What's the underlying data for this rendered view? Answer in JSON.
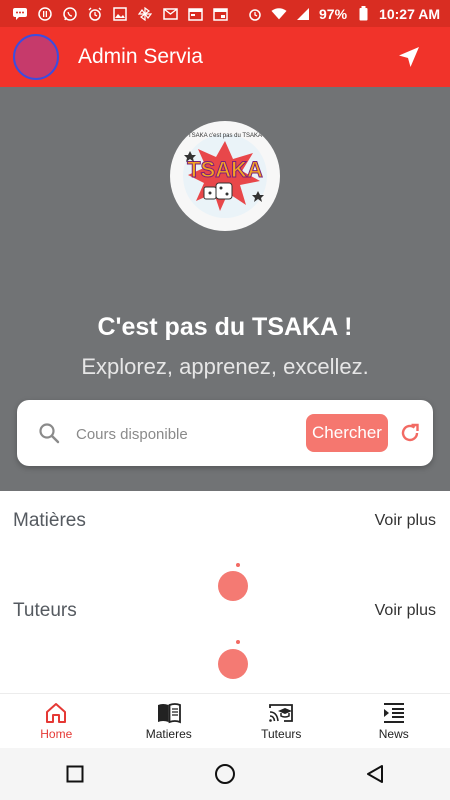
{
  "status_bar": {
    "battery": "97%",
    "time": "10:27 AM"
  },
  "app_bar": {
    "title": "Admin Servia"
  },
  "hero": {
    "logo_text": "TSAKA",
    "logo_ring_text": "TSAKA c'est pas du TSAKA",
    "headline": "C'est pas du TSAKA !",
    "subline": "Explorez, apprenez, excellez."
  },
  "search": {
    "placeholder": "Cours disponible",
    "button": "Chercher"
  },
  "sections": {
    "matieres": {
      "title": "Matières",
      "more": "Voir plus"
    },
    "tuteurs": {
      "title": "Tuteurs",
      "more": "Voir plus"
    }
  },
  "bottom_nav": {
    "items": [
      {
        "label": "Home",
        "icon": "home-icon",
        "active": true
      },
      {
        "label": "Matieres",
        "icon": "book-icon",
        "active": false
      },
      {
        "label": "Tuteurs",
        "icon": "cast-education-icon",
        "active": false
      },
      {
        "label": "News",
        "icon": "news-list-icon",
        "active": false
      }
    ]
  },
  "colors": {
    "status_bar": "#d92d22",
    "app_bar": "#f1332a",
    "hero_bg": "#717375",
    "accent": "#f5776f",
    "active_nav": "#e53935"
  }
}
